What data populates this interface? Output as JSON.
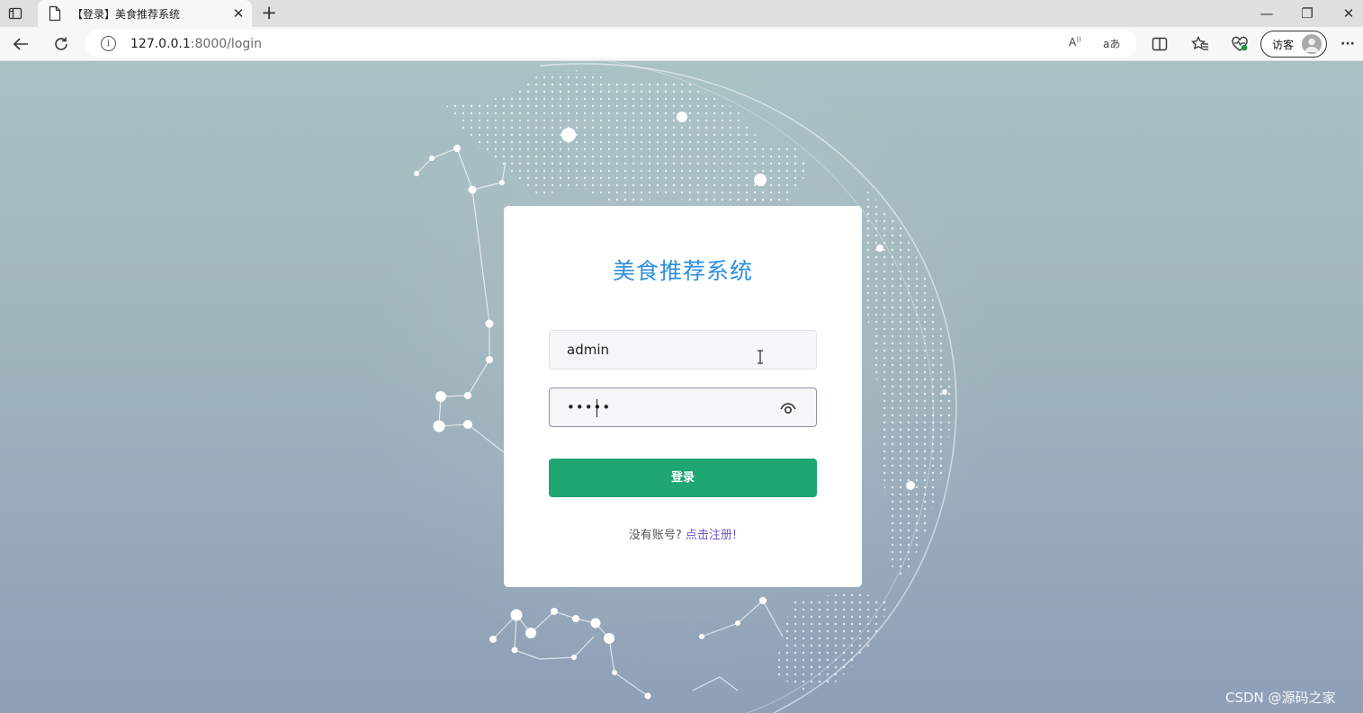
{
  "browser": {
    "tab": {
      "title": "【登录】美食推荐系统",
      "close_glyph": "✕"
    },
    "new_tab_glyph": "+",
    "window_controls": {
      "minimize": "—",
      "restore": "❐",
      "close": "✕"
    },
    "url": {
      "host": "127.0.0.1",
      "path": ":8000/login"
    },
    "read_aloud_label": "A",
    "translate_label": "aあ",
    "profile_label": "访客",
    "more_glyph": "···"
  },
  "login": {
    "title": "美食推荐系统",
    "username_value": "admin",
    "password_value": "•••••",
    "submit_label": "登录",
    "register_prompt": "没有账号? ",
    "register_link": "点击注册!"
  },
  "watermark": "CSDN @源码之家",
  "colors": {
    "title_blue": "#2b8fe0",
    "button_green": "#1fa672",
    "link_purple": "#7055c0"
  }
}
